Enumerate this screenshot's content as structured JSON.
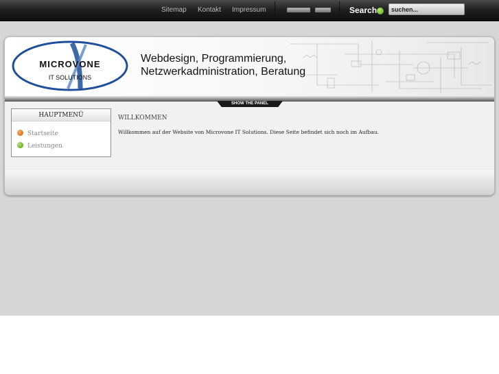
{
  "topbar": {
    "links": [
      "Sitemap",
      "Kontakt",
      "Impressum"
    ],
    "search_label": "Search",
    "search_value": "suchen..."
  },
  "header": {
    "logo_name": "MICROVONE",
    "logo_sub": "IT SOLUTIONS",
    "tagline_line1": "Webdesign, Programmierung,",
    "tagline_line2": "Netzwerkadministration, Beratung",
    "panel_toggle": "SHOW THE PANEL"
  },
  "menu": {
    "title": "HAUPTMENÜ",
    "items": [
      {
        "label": "Startseite",
        "icon": "bullet-orange-icon",
        "color": "#d9731c"
      },
      {
        "label": "Leistungen",
        "icon": "bullet-green-icon",
        "color": "#6aae22"
      }
    ]
  },
  "main": {
    "heading": "WILLKOMMEN",
    "body": "Willkommen auf der Website von Microvone IT Solutions. Diese Seite befindet sich noch im Aufbau."
  },
  "colors": {
    "background": "#d6d6d6",
    "topbar": "#1a1a1a",
    "logo_blue": "#1f4f9a"
  }
}
